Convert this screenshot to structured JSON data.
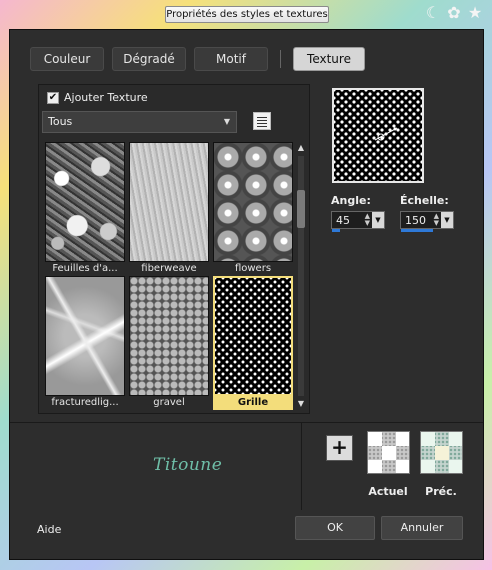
{
  "window": {
    "title": "Propriétés des styles et textures",
    "icons": [
      "moon-icon",
      "flower-icon",
      "star-icon"
    ]
  },
  "tabs": [
    {
      "label": "Couleur"
    },
    {
      "label": "Dégradé"
    },
    {
      "label": "Motif"
    },
    {
      "label": "Texture",
      "selected": true
    }
  ],
  "texture": {
    "checkbox_label": "Ajouter Texture",
    "checkbox_checked": true,
    "category": "Tous",
    "items": [
      {
        "name": "Feuilles d'a..."
      },
      {
        "name": "fiberweave"
      },
      {
        "name": "flowers"
      },
      {
        "name": "fracturedlig..."
      },
      {
        "name": "gravel"
      },
      {
        "name": "Grille",
        "selected": true
      }
    ]
  },
  "controls": {
    "angle_label": "Angle:",
    "angle_value": "45",
    "scale_label": "Échelle:",
    "scale_value": "150"
  },
  "signature": "Titoune",
  "swatches": {
    "current_label": "Actuel",
    "previous_label": "Préc."
  },
  "buttons": {
    "help": "Aide",
    "ok": "OK",
    "cancel": "Annuler"
  },
  "colors": {
    "selection": "#f3dd7b",
    "accent": "#2e79d8",
    "dialog_bg": "#2d2d2d"
  }
}
